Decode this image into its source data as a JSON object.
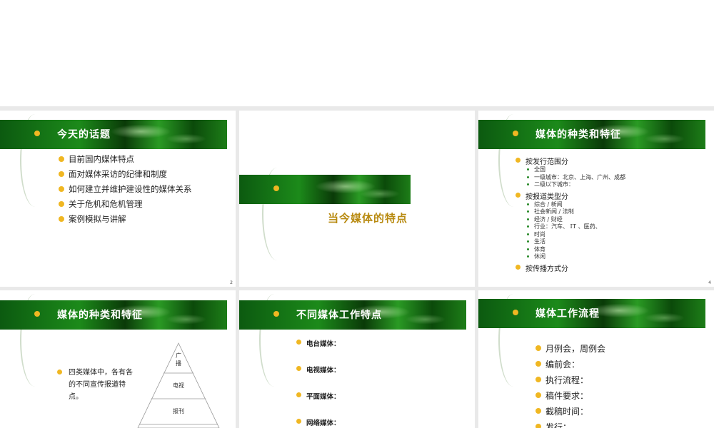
{
  "slides": {
    "s1": {
      "title": "今天的话题",
      "items": [
        "目前国内媒体特点",
        "面对媒体采访的纪律和制度",
        "如何建立并维护建设性的媒体关系",
        "关于危机和危机管理",
        "案例模拟与讲解"
      ],
      "page": "2"
    },
    "s2": {
      "title": "当今媒体的特点"
    },
    "s3": {
      "title": "媒体的种类和特征",
      "groups": [
        {
          "label": "按发行范围分",
          "subs": [
            "全国",
            "一级城市：北京、上海、广州、成都",
            "二级以下城市："
          ]
        },
        {
          "label": "按报道类型分",
          "subs": [
            "综合 / 新闻",
            "社会新闻 / 法制",
            "经济 / 财经",
            "行业：汽车、 IT 、医药、",
            "时尚",
            "生活",
            "体育",
            "休闲"
          ]
        },
        {
          "label": "按传播方式分",
          "subs": []
        }
      ],
      "page": "4"
    },
    "s4": {
      "title": "媒体的种类和特征",
      "text": [
        "四类媒体中，各有各",
        "的不同宣传报道特",
        "点。"
      ],
      "pyramid": [
        "广",
        "播",
        "电视",
        "报刊"
      ]
    },
    "s5": {
      "title": "不同媒体工作特点",
      "items": [
        "电台媒体：",
        "电视媒体：",
        "平面媒体：",
        "网络媒体："
      ]
    },
    "s6": {
      "title": "媒体工作流程",
      "items": [
        "月例会，周例会",
        "编前会：",
        "执行流程：",
        "稿件要求：",
        "截稿时间：",
        "发行："
      ]
    }
  },
  "colors": {
    "band_green": "#1c8a1a",
    "bullet": "#f0b722",
    "section_title": "#b88a10"
  }
}
